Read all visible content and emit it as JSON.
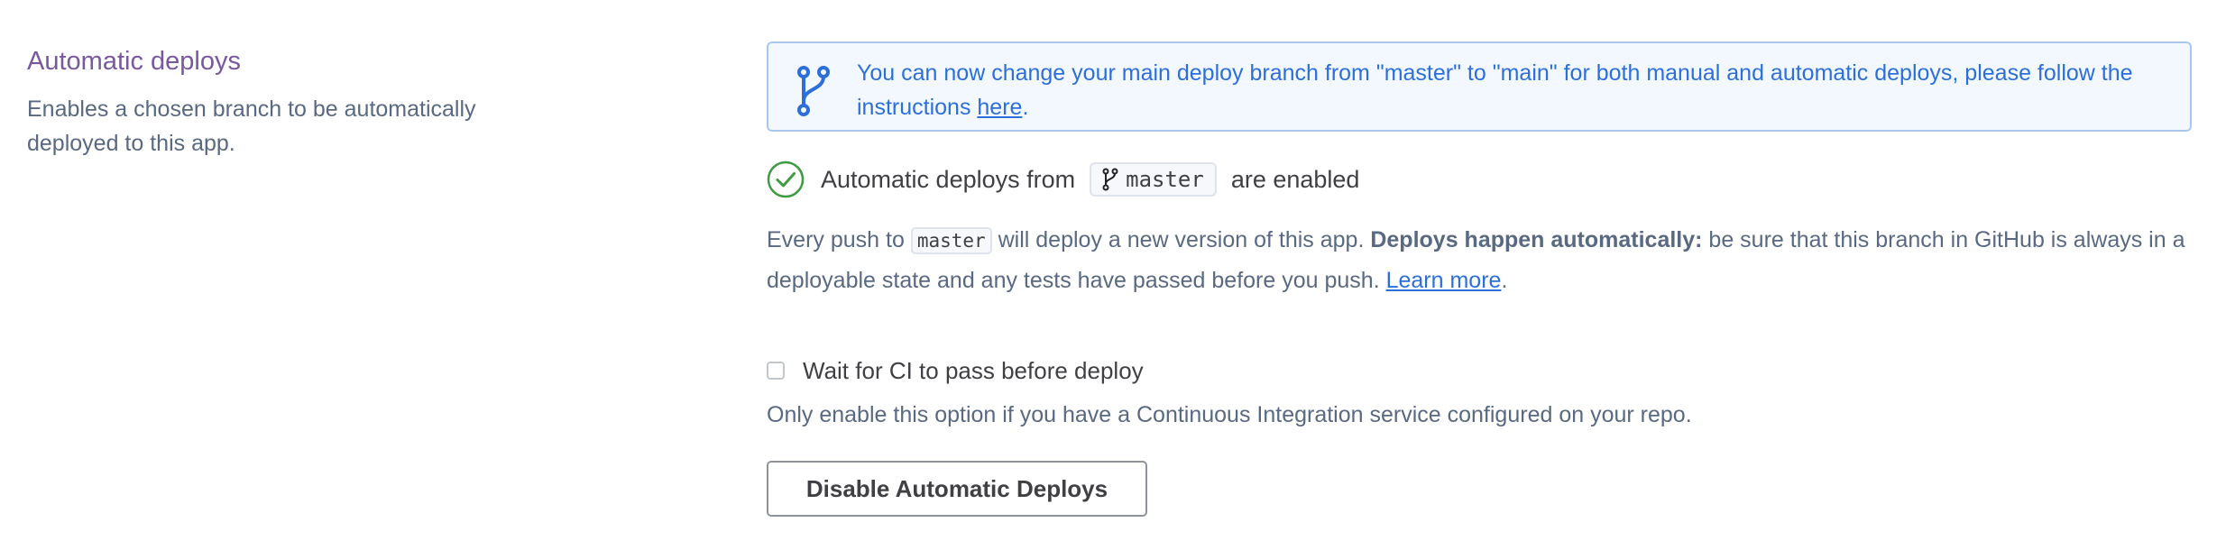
{
  "section": {
    "title": "Automatic deploys",
    "description": "Enables a chosen branch to be automatically deployed to this app."
  },
  "notice": {
    "icon": "git-branch-icon",
    "text": "You can now change your main deploy branch from \"master\" to \"main\" for both manual and automatic deploys, please follow the instructions ",
    "link": "here",
    "suffix": ".",
    "color": "#2c6fdb"
  },
  "status": {
    "icon": "check-circle-icon",
    "prefix": "Automatic deploys from",
    "branch": "master",
    "suffix": "are enabled",
    "color": "#3f9b46"
  },
  "description": {
    "part1": "Every push to ",
    "branch": "master",
    "part2": " will deploy a new version of this app. ",
    "bold": "Deploys happen automatically:",
    "part3": " be sure that this branch in GitHub is always in a deployable state and any tests have passed before you push. ",
    "link": "Learn more",
    "suffix": "."
  },
  "ci_option": {
    "label": "Wait for CI to pass before deploy",
    "help": "Only enable this option if you have a Continuous Integration service configured on your repo.",
    "checked": false
  },
  "actions": {
    "disable_label": "Disable Automatic Deploys"
  }
}
